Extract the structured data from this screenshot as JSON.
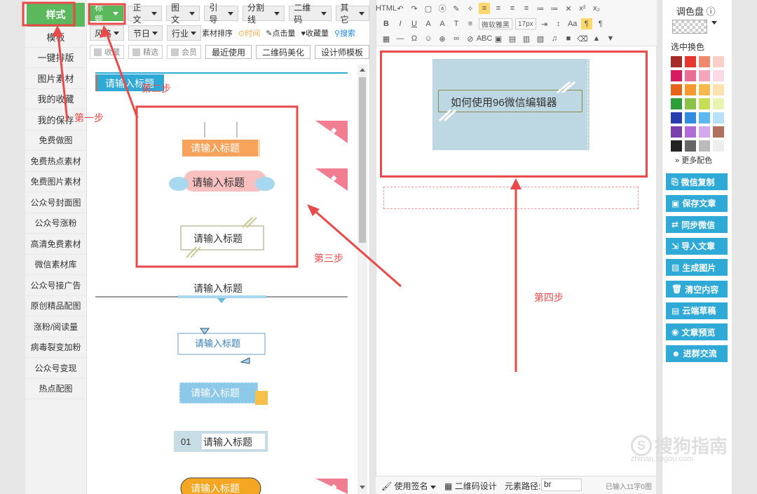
{
  "nav": {
    "style": "样式",
    "items": [
      "模板",
      "一键排版",
      "图片素材",
      "我的收藏",
      "我的保存",
      "免费做图",
      "免费热点素材",
      "免费图片素材",
      "公众号封面图",
      "公众号涨粉",
      "高清免费素材",
      "微信素材库",
      "公众号接广告",
      "原创精品配图",
      "涨粉/阅读量",
      "病毒裂变加粉",
      "公众号变现",
      "热点配图"
    ]
  },
  "toolbar": {
    "row1": [
      "标题",
      "正文",
      "图文",
      "引导",
      "分割线",
      "二维码",
      "其它"
    ],
    "row2": [
      "风格",
      "节日",
      "行业"
    ],
    "sort_label": "素材排序",
    "sort_time": "时间",
    "sort_hits": "点击量",
    "sort_fav": "收藏量",
    "search": "搜索",
    "row3_checks": [
      "收藏",
      "精选",
      "会员"
    ],
    "row3_buttons": [
      "最近使用",
      "二维码美化",
      "设计师模板"
    ]
  },
  "styles": {
    "placeholder": "请输入标题",
    "num_label": "01"
  },
  "editor": {
    "font": "微软雅黑",
    "size": "17px",
    "preview_text": "如何使用96微信编辑器",
    "status_sign": "使用签名",
    "status_qr": "二维码设计",
    "status_path": "元素路径:",
    "status_path_value": "br",
    "status_count": "已输入11字0图"
  },
  "palette": {
    "title": "调色盘",
    "select_change": "选中换色",
    "more": "更多配色",
    "colors": [
      "#a52a2a",
      "#e8352e",
      "#f08a6e",
      "#f8d0c8",
      "#d81b60",
      "#ec6d96",
      "#f4a6bd",
      "#fadbe5",
      "#e8631a",
      "#f79a2e",
      "#f5b94a",
      "#fde2b0",
      "#2e9e3a",
      "#8bc34a",
      "#c5de56",
      "#e8f4b0",
      "#2a3fae",
      "#2e8de0",
      "#5cb8f0",
      "#b8e0f8",
      "#7b3fae",
      "#b06bd9",
      "#d4a8ec",
      "#b07060",
      "#222222",
      "#666666",
      "#bbbbbb",
      "#eeeeee"
    ],
    "buttons": [
      "微信复制",
      "保存文章",
      "同步微信",
      "导入文章",
      "生成图片",
      "清空内容",
      "云端草稿",
      "文章预览",
      "进群交流"
    ]
  },
  "annotations": {
    "step1": "第一步",
    "step2": "第二步",
    "step3": "第三步",
    "step4": "第四步"
  },
  "watermark": {
    "brand": "搜狗指南",
    "url": "zhinan.sogou.com"
  }
}
